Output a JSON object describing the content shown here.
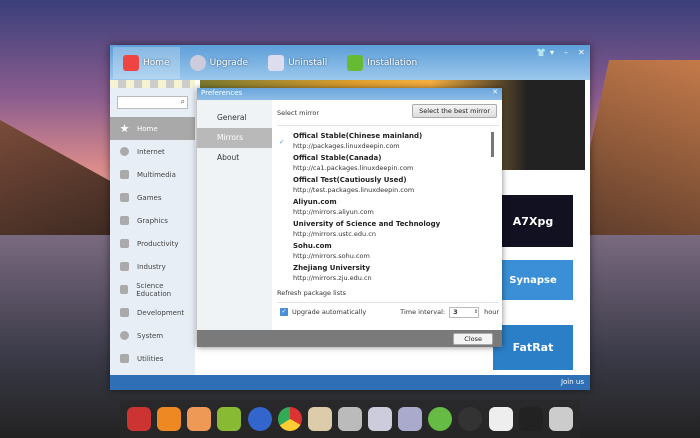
{
  "toolbar": {
    "tabs": [
      {
        "label": "Home"
      },
      {
        "label": "Upgrade"
      },
      {
        "label": "Uninstall"
      },
      {
        "label": "Installation"
      }
    ]
  },
  "sidebar": {
    "search_placeholder": "",
    "items": [
      {
        "label": "Home"
      },
      {
        "label": "Internet"
      },
      {
        "label": "Multimedia"
      },
      {
        "label": "Games"
      },
      {
        "label": "Graphics"
      },
      {
        "label": "Productivity"
      },
      {
        "label": "Industry"
      },
      {
        "label": "Science Education"
      },
      {
        "label": "Development"
      },
      {
        "label": "System"
      },
      {
        "label": "Utilities"
      }
    ]
  },
  "cards": [
    {
      "label": "A7Xpg"
    },
    {
      "label": "Synapse"
    },
    {
      "label": "FatRat"
    }
  ],
  "footer": {
    "join": "Join us"
  },
  "dialog": {
    "title": "Preferences",
    "nav": [
      {
        "label": "General"
      },
      {
        "label": "Mirrors"
      },
      {
        "label": "About"
      }
    ],
    "select_mirror": "Select mirror",
    "best_button": "Select the best mirror",
    "mirrors": [
      {
        "name": "Offical Stable(Chinese mainland)",
        "url": "http://packages.linuxdeepin.com",
        "selected": true
      },
      {
        "name": "Offical Stable(Canada)",
        "url": "http://ca1.packages.linuxdeepin.com"
      },
      {
        "name": "Offical Test(Cautiously Used)",
        "url": "http://test.packages.linuxdeepin.com"
      },
      {
        "name": "Aliyun.com",
        "url": "http://mirrors.aliyun.com"
      },
      {
        "name": "University of Science and Technology",
        "url": "http://mirrors.ustc.edu.cn"
      },
      {
        "name": "Sohu.com",
        "url": "http://mirrors.sohu.com"
      },
      {
        "name": "Zhejiang University",
        "url": "http://mirrors.zju.edu.cn"
      }
    ],
    "refresh": "Refresh package lists",
    "upgrade_auto": "Upgrade automatically",
    "interval_label": "Time interval:",
    "interval_value": "3",
    "interval_unit": "hour",
    "close": "Close"
  }
}
